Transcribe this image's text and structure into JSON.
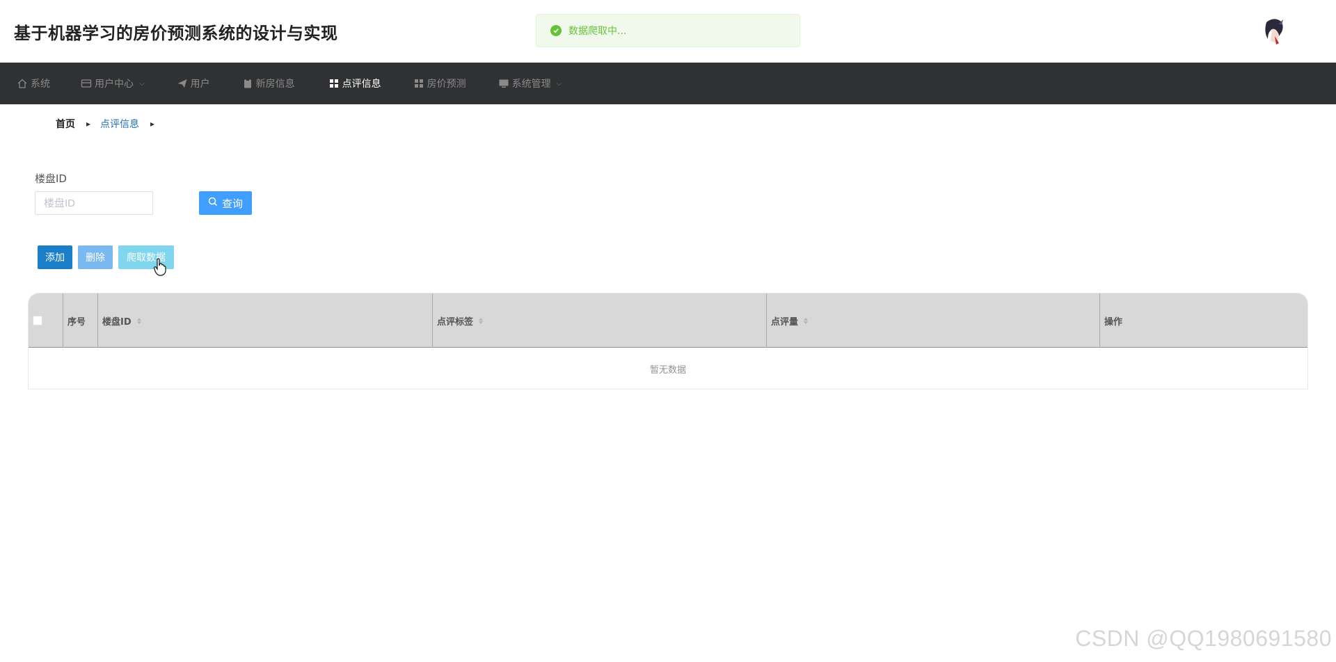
{
  "header": {
    "title": "基于机器学习的房价预测系统的设计与实现",
    "toast": "数据爬取中..."
  },
  "nav": {
    "items": [
      {
        "label": "系统",
        "icon": "home-icon"
      },
      {
        "label": "用户中心",
        "icon": "user-center-icon",
        "dropdown": true
      },
      {
        "label": "用户",
        "icon": "send-icon"
      },
      {
        "label": "新房信息",
        "icon": "clipboard-icon"
      },
      {
        "label": "点评信息",
        "icon": "grid-icon",
        "active": true
      },
      {
        "label": "房价预测",
        "icon": "grid-icon"
      },
      {
        "label": "系统管理",
        "icon": "monitor-icon",
        "dropdown": true
      }
    ]
  },
  "breadcrumb": {
    "home": "首页",
    "current": "点评信息"
  },
  "search": {
    "label": "楼盘ID",
    "placeholder": "楼盘ID",
    "button": "查询"
  },
  "actions": {
    "add": "添加",
    "delete": "删除",
    "crawl": "爬取数据"
  },
  "table": {
    "columns": [
      "序号",
      "楼盘ID",
      "点评标签",
      "点评量",
      "操作"
    ],
    "empty": "暂无数据"
  },
  "watermark": "CSDN @QQ1980691580",
  "colors": {
    "navbar": "#303133",
    "primary": "#409eff",
    "success": "#67c23a"
  }
}
